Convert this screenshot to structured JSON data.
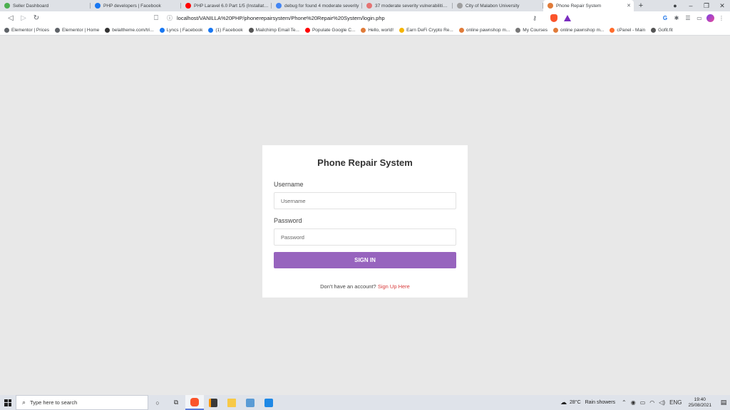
{
  "browser": {
    "tabs": [
      {
        "title": "Seller Dashboard",
        "favicon_color": "#4caf50",
        "active": false
      },
      {
        "title": "PHP developers | Facebook",
        "favicon_color": "#1877f2",
        "active": false
      },
      {
        "title": "PHP Laravel 6.0 Part 1/5 (Installation &",
        "favicon_color": "#ff0000",
        "active": false
      },
      {
        "title": "debug for found 4 moderate severity",
        "favicon_color": "#4285f4",
        "active": false
      },
      {
        "title": "37 moderate severity vulnerabilities -",
        "favicon_color": "#e57373",
        "active": false
      },
      {
        "title": "City of Malabon University",
        "favicon_color": "#9e9e9e",
        "active": false
      },
      {
        "title": "Phone Repair System",
        "favicon_color": "#e07b39",
        "active": true
      }
    ],
    "new_tab_symbol": "+",
    "url": "localhost/VANILLA%20PHP/phonerepairsystem/Phone%20Repair%20System/login.php",
    "bookmarks": [
      {
        "label": "Elementor | Prices",
        "color": "#5f6368"
      },
      {
        "label": "Elementor | Home",
        "color": "#5f6368"
      },
      {
        "label": "belaltheme.com/tri...",
        "color": "#333333"
      },
      {
        "label": "Lyncs | Facebook",
        "color": "#1877f2"
      },
      {
        "label": "(1) Facebook",
        "color": "#1877f2"
      },
      {
        "label": "Mailchimp Email Te...",
        "color": "#555555"
      },
      {
        "label": "Populate Google C...",
        "color": "#ff0000"
      },
      {
        "label": "Hello, world!",
        "color": "#e07b39"
      },
      {
        "label": "Earn DeFi Crypto Re...",
        "color": "#f5b400"
      },
      {
        "label": "online pawnshop m...",
        "color": "#e07b39"
      },
      {
        "label": "My Courses",
        "color": "#777777"
      },
      {
        "label": "online pawnshop m...",
        "color": "#e07b39"
      },
      {
        "label": "cPanel - Main",
        "color": "#ff6c2c"
      },
      {
        "label": "Gofit.fit",
        "color": "#555555"
      }
    ]
  },
  "login": {
    "title": "Phone Repair System",
    "username_label": "Username",
    "username_placeholder": "Username",
    "password_label": "Password",
    "password_placeholder": "Password",
    "submit_label": "SIGN IN",
    "signup_prompt": "Don't have an account?",
    "signup_link": "Sign Up Here",
    "accent_color": "#9764be",
    "link_color": "#d83a3a"
  },
  "taskbar": {
    "search_placeholder": "Type here to search",
    "weather_temp": "28°C",
    "weather_desc": "Rain showers",
    "language": "ENG",
    "time": "19:40",
    "date": "25/08/2021"
  }
}
